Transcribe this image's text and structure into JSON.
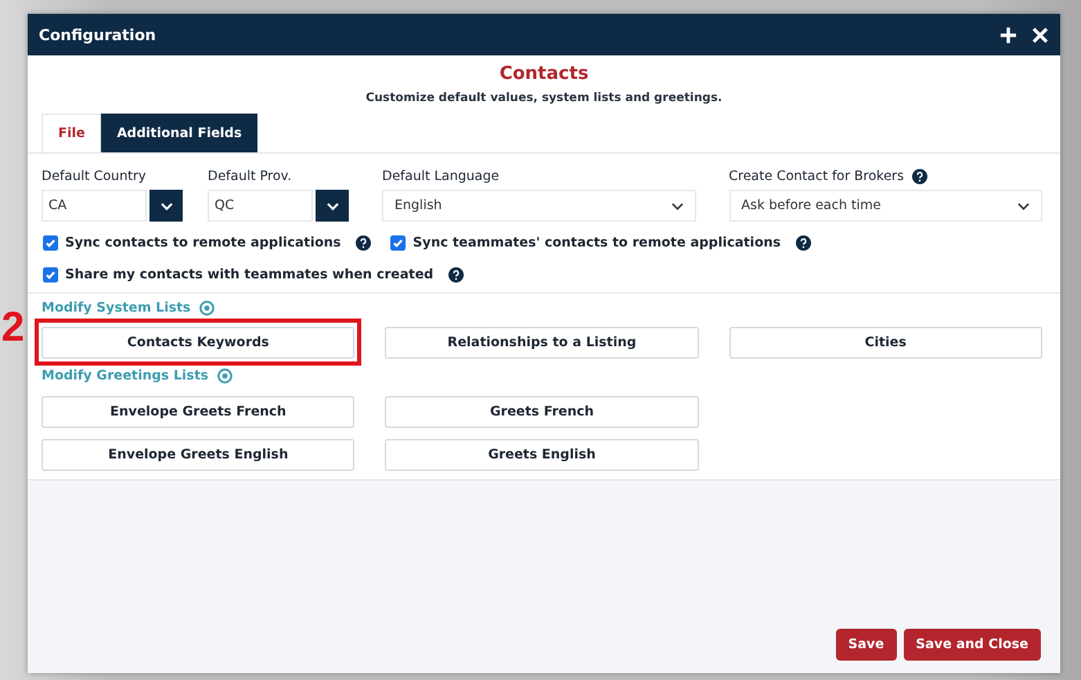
{
  "window": {
    "title": "Configuration"
  },
  "header": {
    "title": "Contacts",
    "subtitle": "Customize default values, system lists and greetings."
  },
  "tabs": [
    {
      "label": "File",
      "selected": true
    },
    {
      "label": "Additional Fields",
      "selected": false
    }
  ],
  "fields": [
    {
      "kind": "combo",
      "label": "Default Country",
      "value": "CA"
    },
    {
      "kind": "combo",
      "label": "Default Prov.",
      "value": "QC"
    },
    {
      "kind": "select",
      "label": "Default Language",
      "value": "English"
    },
    {
      "kind": "select",
      "label": "Create Contact for Brokers",
      "value": "Ask before each time",
      "help": true
    }
  ],
  "checkboxes": [
    {
      "label": "Sync contacts to remote applications",
      "checked": true
    },
    {
      "label": "Sync teammates' contacts to remote applications",
      "checked": true
    },
    {
      "label": "Share my contacts with teammates when created",
      "checked": true
    }
  ],
  "system_lists": {
    "title": "Modify System Lists",
    "buttons": [
      {
        "label": "Contacts Keywords",
        "highlighted": true
      },
      {
        "label": "Relationships to a Listing",
        "highlighted": false
      },
      {
        "label": "Cities",
        "highlighted": false
      }
    ]
  },
  "greetings_lists": {
    "title": "Modify Greetings Lists",
    "buttons": [
      {
        "label": "Envelope Greets French"
      },
      {
        "label": "Greets French"
      },
      {
        "label": "Envelope Greets English"
      },
      {
        "label": "Greets English"
      }
    ]
  },
  "annotation": {
    "label": "2"
  },
  "footer_buttons": [
    "Save",
    "Save and Close"
  ]
}
